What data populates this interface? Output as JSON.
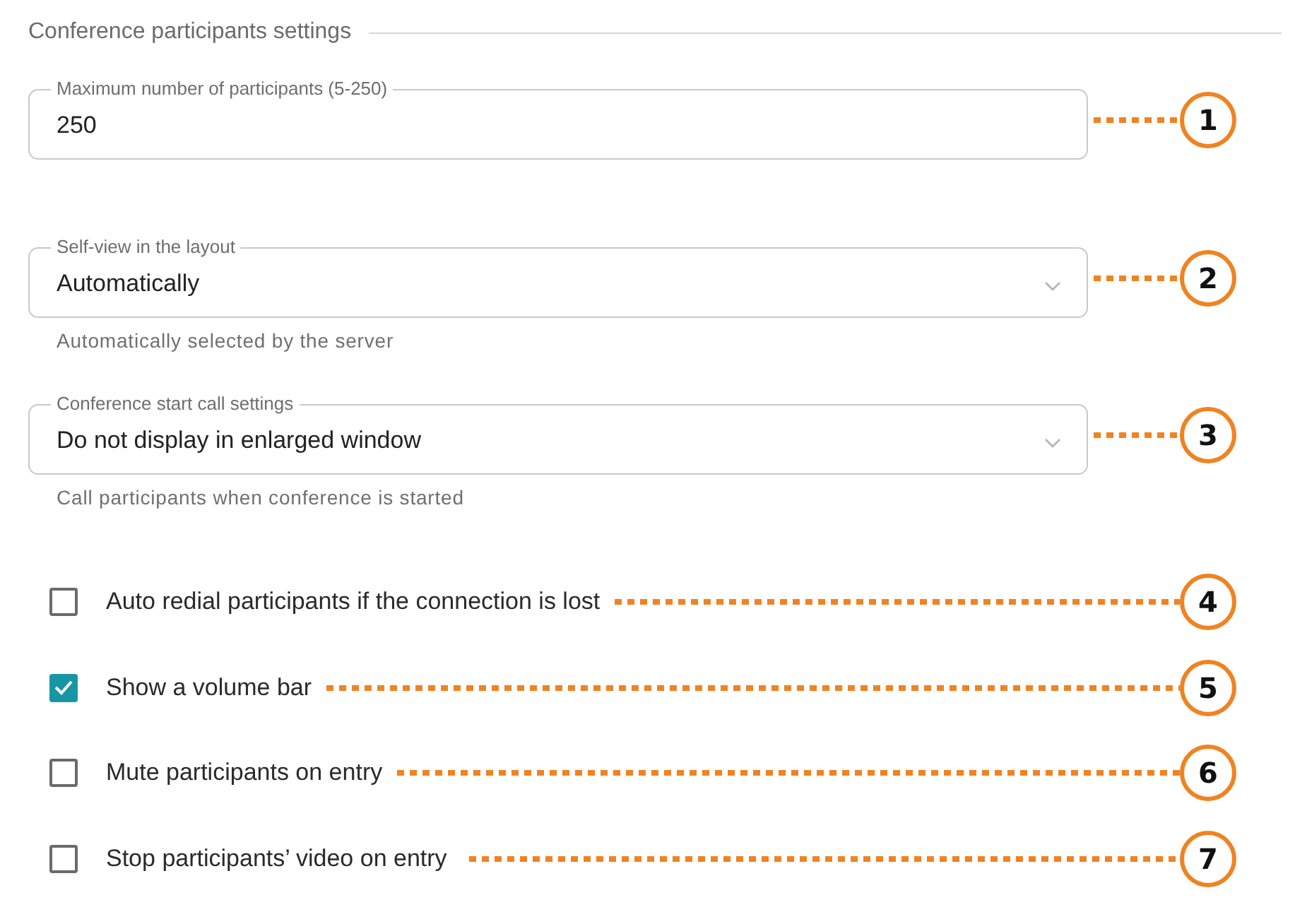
{
  "section": {
    "title": "Conference participants settings"
  },
  "fields": [
    {
      "kind": "input",
      "label": "Maximum number of participants (5-250)",
      "value": "250",
      "callout": "1"
    },
    {
      "kind": "select",
      "label": "Self-view in the layout",
      "value": "Automatically",
      "helper": "Automatically selected by the server",
      "callout": "2"
    },
    {
      "kind": "select",
      "label": "Conference start call settings",
      "value": "Do not display in enlarged window",
      "helper": "Call participants when conference is started",
      "callout": "3"
    }
  ],
  "options": [
    {
      "label": "Auto redial participants if the connection is lost",
      "checked": false,
      "callout": "4"
    },
    {
      "label": "Show a volume bar",
      "checked": true,
      "callout": "5"
    },
    {
      "label": "Mute participants on entry",
      "checked": false,
      "callout": "6"
    },
    {
      "label": "Stop participants’ video on entry",
      "checked": false,
      "callout": "7"
    }
  ]
}
